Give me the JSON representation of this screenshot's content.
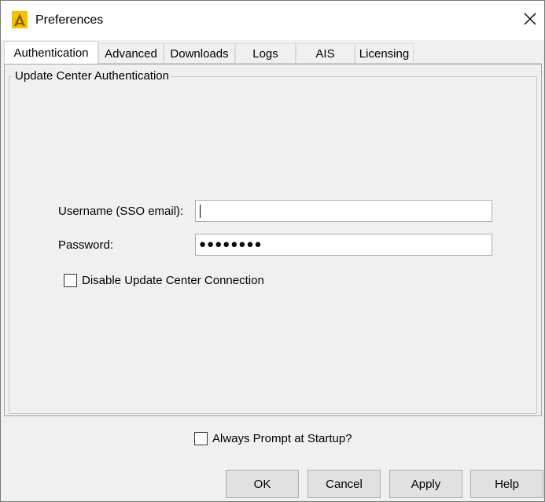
{
  "window": {
    "title": "Preferences"
  },
  "tabs": [
    {
      "label": "Authentication",
      "active": true
    },
    {
      "label": "Advanced",
      "active": false
    },
    {
      "label": "Downloads",
      "active": false
    },
    {
      "label": "Logs",
      "active": false
    },
    {
      "label": "AIS",
      "active": false
    },
    {
      "label": "Licensing",
      "active": false
    }
  ],
  "auth": {
    "group_title": "Update Center Authentication",
    "username_label": "Username (SSO email):",
    "username_value": "",
    "password_label": "Password:",
    "password_value": "●●●●●●●●",
    "disable_label": "Disable Update Center Connection",
    "disable_checked": false
  },
  "footer": {
    "prompt_label": "Always Prompt at Startup?",
    "prompt_checked": false,
    "ok_label": "OK",
    "cancel_label": "Cancel",
    "apply_label": "Apply",
    "help_label": "Help"
  },
  "icons": {
    "app": "app-logo-icon",
    "close": "close-icon"
  },
  "colors": {
    "window_bg": "#f0f0f0",
    "titlebar_bg": "#ffffff",
    "logo_yellow": "#f2c200",
    "button_bg": "#e1e1e1"
  }
}
